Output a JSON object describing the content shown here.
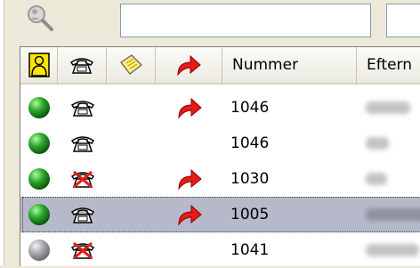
{
  "columns": {
    "status": "person-icon",
    "phone": "phone-icon",
    "note": "note-icon",
    "forward": "forward-arrow-icon",
    "number_label": "Nummer",
    "lastname_label": "Eftern"
  },
  "rows": [
    {
      "status": "available",
      "phone": "phone",
      "forwarded": true,
      "number": "1046",
      "selected": false
    },
    {
      "status": "available",
      "phone": "phone",
      "forwarded": false,
      "number": "1046",
      "selected": false
    },
    {
      "status": "available",
      "phone": "phone-unavailable",
      "forwarded": true,
      "number": "1030",
      "selected": false
    },
    {
      "status": "available",
      "phone": "phone",
      "forwarded": true,
      "number": "1005",
      "selected": true
    },
    {
      "status": "offline",
      "phone": "phone-unavailable",
      "forwarded": false,
      "number": "1041",
      "selected": false
    }
  ],
  "colors": {
    "available": "#1f8f1f",
    "offline": "#8a8a8a",
    "forward": "#e41b17",
    "selected_row": "#b5b9c9"
  }
}
